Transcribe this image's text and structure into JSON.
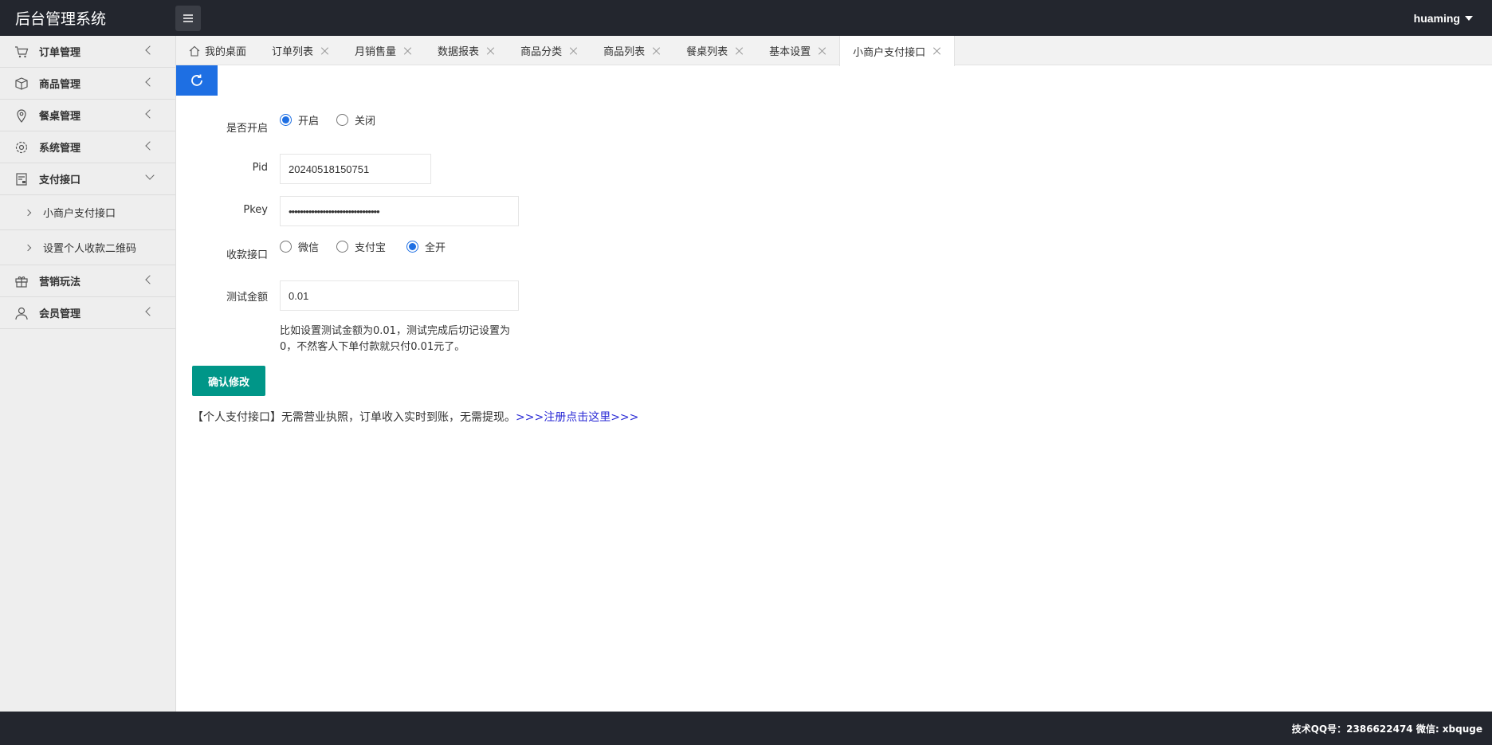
{
  "header": {
    "title": "后台管理系统",
    "user": "huaming"
  },
  "sidebar": {
    "items": [
      {
        "label": "订单管理",
        "icon": "cart-icon"
      },
      {
        "label": "商品管理",
        "icon": "box-icon"
      },
      {
        "label": "餐桌管理",
        "icon": "location-icon"
      },
      {
        "label": "系统管理",
        "icon": "gear-icon"
      },
      {
        "label": "支付接口",
        "icon": "payment-icon",
        "expanded": true
      },
      {
        "label": "营销玩法",
        "icon": "gift-icon"
      },
      {
        "label": "会员管理",
        "icon": "user-icon"
      }
    ],
    "subitems": [
      "小商户支付接口",
      "设置个人收款二维码"
    ]
  },
  "tabs": [
    "我的桌面",
    "订单列表",
    "月销售量",
    "数据报表",
    "商品分类",
    "商品列表",
    "餐桌列表",
    "基本设置",
    "小商户支付接口"
  ],
  "form": {
    "enable_label": "是否开启",
    "enable_on": "开启",
    "enable_off": "关闭",
    "pid_label": "Pid",
    "pid_value": "20240518150751",
    "pkey_label": "Pkey",
    "pkey_value": "••••••••••••••••••••••••••••••••",
    "channel_label": "收款接口",
    "channel_wechat": "微信",
    "channel_alipay": "支付宝",
    "channel_all": "全开",
    "amount_label": "测试金额",
    "amount_value": "0.01",
    "hint": "比如设置测试金额为0.01，测试完成后切记设置为0，不然客人下单付款就只付0.01元了。",
    "submit": "确认修改"
  },
  "note": {
    "text": "【个人支付接口】无需营业执照，订单收入实时到账，无需提现。",
    "link": ">>>注册点击这里>>>"
  },
  "footer": {
    "text": "技术QQ号：2386622474 微信: xbquge"
  },
  "colors": {
    "header_bg": "#23262e",
    "primary": "#1e6fe3",
    "submit": "#009688",
    "link": "#2b2bd6"
  }
}
